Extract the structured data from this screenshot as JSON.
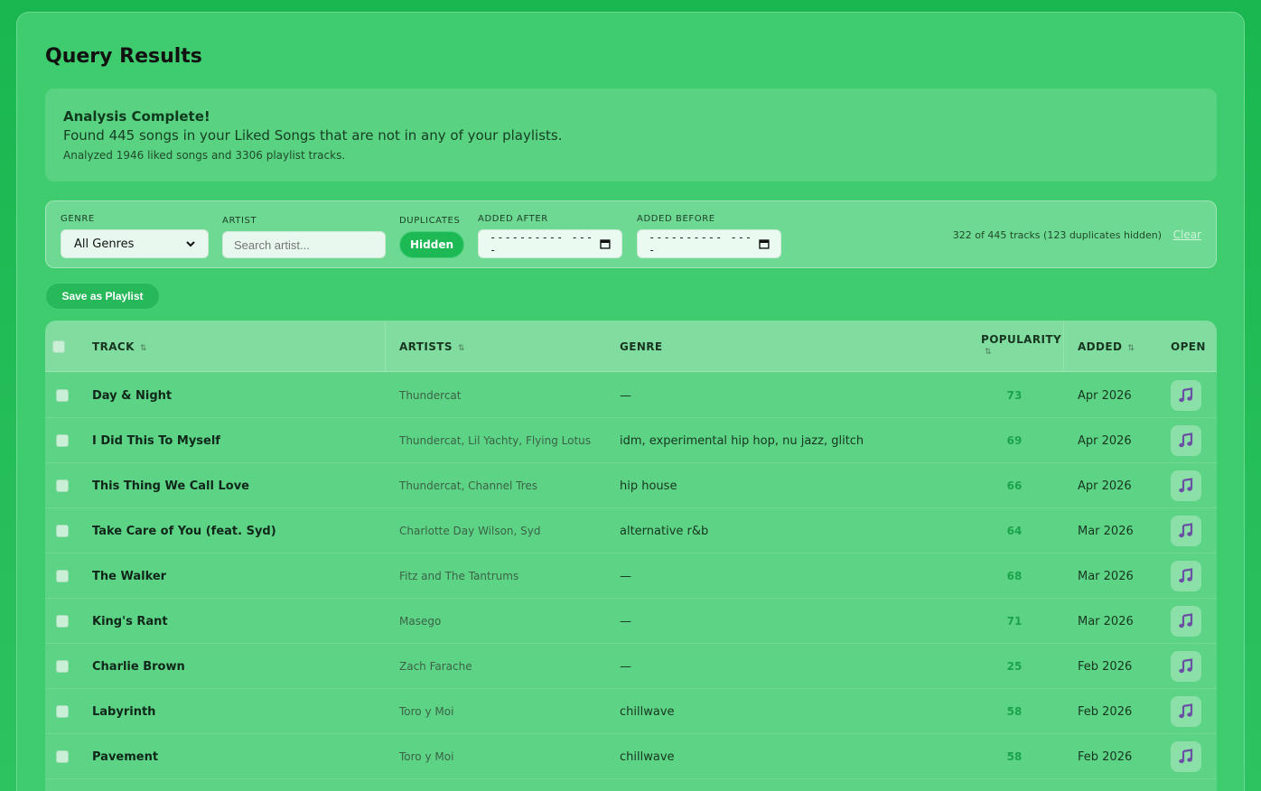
{
  "page": {
    "title": "Query Results"
  },
  "summary": {
    "title": "Analysis Complete!",
    "main": "Found 445 songs in your Liked Songs that are not in any of your playlists.",
    "sub": "Analyzed 1946 liked songs and 3306 playlist tracks."
  },
  "filters": {
    "genre_label": "GENRE",
    "genre_value": "All Genres",
    "artist_label": "ARTIST",
    "artist_placeholder": "Search artist...",
    "duplicates_label": "DUPLICATES",
    "duplicates_value": "Hidden",
    "added_after_label": "ADDED AFTER",
    "added_after_value": "---------- ----",
    "added_before_label": "ADDED BEFORE",
    "added_before_value": "---------- ----",
    "count_text": "322 of 445 tracks (123 duplicates hidden)",
    "clear_label": "Clear"
  },
  "actions": {
    "save_label": "Save as Playlist"
  },
  "table": {
    "headers": {
      "track": "TRACK",
      "artists": "ARTISTS",
      "genre": "GENRE",
      "popularity": "POPULARITY",
      "added": "ADDED",
      "open": "OPEN"
    },
    "sort_glyph": "⇅",
    "rows": [
      {
        "track": "Day & Night",
        "artists": "Thundercat",
        "genre": "—",
        "popularity": "73",
        "added": "Apr 2026"
      },
      {
        "track": "I Did This To Myself",
        "artists": "Thundercat, Lil Yachty, Flying Lotus",
        "genre": "idm, experimental hip hop, nu jazz, glitch",
        "popularity": "69",
        "added": "Apr 2026"
      },
      {
        "track": "This Thing We Call Love",
        "artists": "Thundercat, Channel Tres",
        "genre": "hip house",
        "popularity": "66",
        "added": "Apr 2026"
      },
      {
        "track": "Take Care of You (feat. Syd)",
        "artists": "Charlotte Day Wilson, Syd",
        "genre": "alternative r&b",
        "popularity": "64",
        "added": "Mar 2026"
      },
      {
        "track": "The Walker",
        "artists": "Fitz and The Tantrums",
        "genre": "—",
        "popularity": "68",
        "added": "Mar 2026"
      },
      {
        "track": "King's Rant",
        "artists": "Masego",
        "genre": "—",
        "popularity": "71",
        "added": "Mar 2026"
      },
      {
        "track": "Charlie Brown",
        "artists": "Zach Farache",
        "genre": "—",
        "popularity": "25",
        "added": "Feb 2026"
      },
      {
        "track": "Labyrinth",
        "artists": "Toro y Moi",
        "genre": "chillwave",
        "popularity": "58",
        "added": "Feb 2026"
      },
      {
        "track": "Pavement",
        "artists": "Toro y Moi",
        "genre": "chillwave",
        "popularity": "58",
        "added": "Feb 2026"
      }
    ],
    "open_icon": "music-note-icon"
  }
}
